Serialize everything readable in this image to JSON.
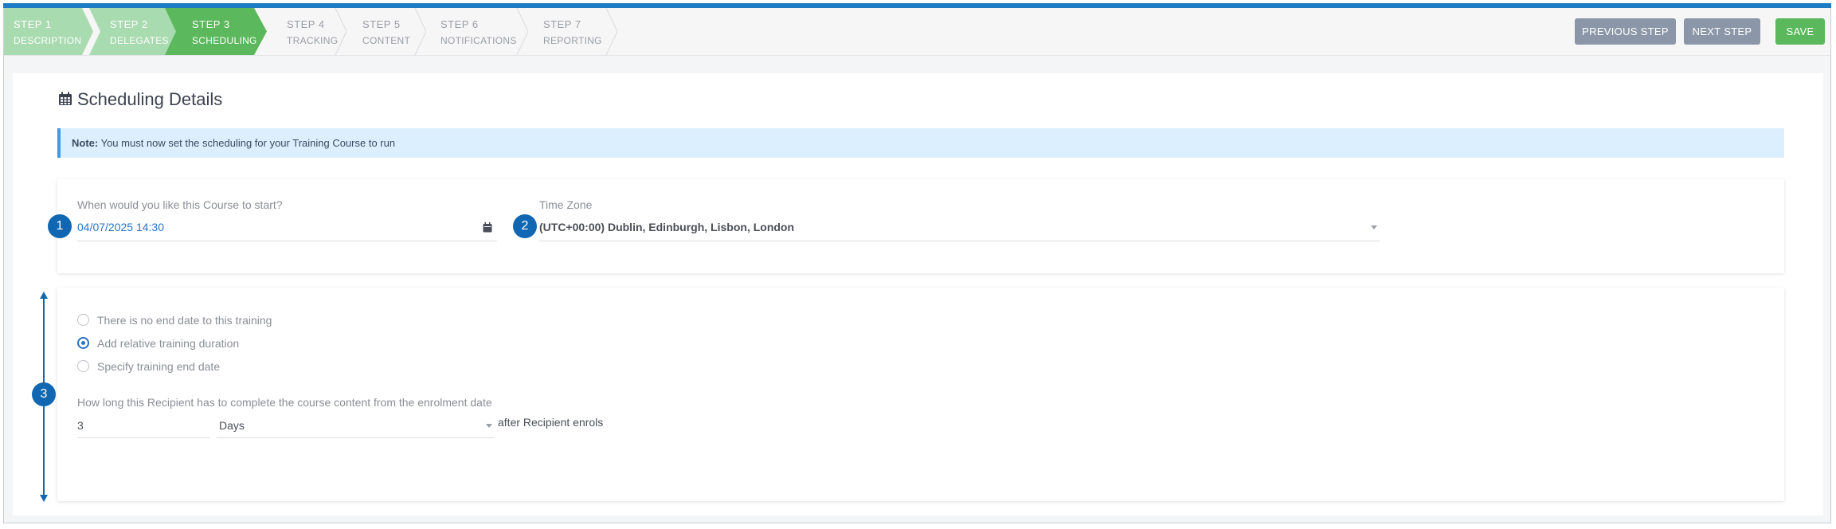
{
  "steps": [
    {
      "num": "STEP 1",
      "name": "DESCRIPTION",
      "state": "done"
    },
    {
      "num": "STEP 2",
      "name": "DELEGATES",
      "state": "done"
    },
    {
      "num": "STEP 3",
      "name": "SCHEDULING",
      "state": "active"
    },
    {
      "num": "STEP 4",
      "name": "TRACKING",
      "state": "todo"
    },
    {
      "num": "STEP 5",
      "name": "CONTENT",
      "state": "todo"
    },
    {
      "num": "STEP 6",
      "name": "NOTIFICATIONS",
      "state": "todo"
    },
    {
      "num": "STEP 7",
      "name": "REPORTING",
      "state": "todo"
    }
  ],
  "buttons": {
    "previous": "PREVIOUS STEP",
    "next": "NEXT STEP",
    "save": "SAVE"
  },
  "colors": {
    "accent": "#1f7cc2",
    "done": "#a8dbb0",
    "active": "#5cb85c",
    "save": "#5cb85c",
    "grey_btn": "#8b97a8",
    "badge": "#1167b1"
  },
  "page": {
    "title": "Scheduling Details",
    "icon": "calendar-icon"
  },
  "note": {
    "prefix": "Note:",
    "text": " You must now set the scheduling for your Training Course to run"
  },
  "start": {
    "label": "When would you like this Course to start?",
    "value": "04/07/2025 14:30",
    "badge": "1"
  },
  "timezone": {
    "label": "Time Zone",
    "value": "(UTC+00:00) Dublin, Edinburgh, Lisbon, London",
    "badge": "2"
  },
  "end_options": {
    "badge": "3",
    "items": [
      {
        "label": "There is no end date to this training",
        "selected": false
      },
      {
        "label": "Add relative training duration",
        "selected": true
      },
      {
        "label": "Specify training end date",
        "selected": false
      }
    ]
  },
  "duration": {
    "label": "How long this Recipient has to complete the course content from the enrolment date",
    "amount": "3",
    "unit": "Days",
    "suffix": "after Recipient enrols"
  }
}
